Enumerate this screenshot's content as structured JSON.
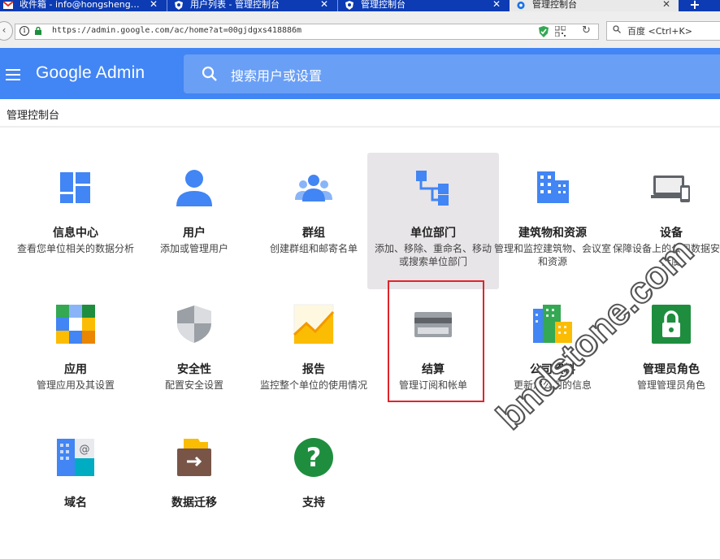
{
  "browser": {
    "tabs": [
      {
        "title": "收件箱 - info@hongsheng…",
        "icon": "gmail-icon",
        "active": false
      },
      {
        "title": "用户列表 - 管理控制台",
        "icon": "admin-icon",
        "active": false
      },
      {
        "title": "管理控制台",
        "icon": "admin-icon",
        "active": false
      },
      {
        "title": "管理控制台",
        "icon": "gear-icon",
        "active": true
      }
    ],
    "close_glyph": "✕",
    "new_tab_glyph": "+",
    "url": "https://admin.google.com/ac/home?at=00gjdgxs418886m",
    "search_placeholder": "百度 <Ctrl+K>"
  },
  "header": {
    "brand": "Google Admin",
    "search_placeholder": "搜索用户或设置",
    "brand_color": "#4285f4"
  },
  "breadcrumb": "管理控制台",
  "tiles": [
    {
      "id": "dashboard",
      "title": "信息中心",
      "desc": "查看您单位相关的数据分析",
      "icon": "dashboard-icon"
    },
    {
      "id": "users",
      "title": "用户",
      "desc": "添加或管理用户",
      "icon": "user-icon"
    },
    {
      "id": "groups",
      "title": "群组",
      "desc": "创建群组和邮寄名单",
      "icon": "group-icon"
    },
    {
      "id": "org-units",
      "title": "单位部门",
      "desc": "添加、移除、重命名、移动或搜索单位部门",
      "icon": "org-unit-icon"
    },
    {
      "id": "buildings",
      "title": "建筑物和资源",
      "desc": "管理和监控建筑物、会议室和资源",
      "icon": "building-icon"
    },
    {
      "id": "devices",
      "title": "设备",
      "desc": "保障设备上的公司数据安全无虞",
      "icon": "devices-icon"
    },
    {
      "id": "apps",
      "title": "应用",
      "desc": "管理应用及其设置",
      "icon": "apps-icon"
    },
    {
      "id": "security",
      "title": "安全性",
      "desc": "配置安全设置",
      "icon": "shield-icon"
    },
    {
      "id": "reports",
      "title": "报告",
      "desc": "监控整个单位的使用情况",
      "icon": "reports-icon"
    },
    {
      "id": "billing",
      "title": "结算",
      "desc": "管理订阅和帐单",
      "icon": "credit-card-icon"
    },
    {
      "id": "company-profile",
      "title": "公司资料",
      "desc": "更新您公司的信息",
      "icon": "company-profile-icon"
    },
    {
      "id": "admin-roles",
      "title": "管理员角色",
      "desc": "管理管理员角色",
      "icon": "lock-icon"
    },
    {
      "id": "domains",
      "title": "域名",
      "desc": "",
      "icon": "domains-icon"
    },
    {
      "id": "data-migration",
      "title": "数据迁移",
      "desc": "",
      "icon": "data-migration-icon"
    },
    {
      "id": "support",
      "title": "支持",
      "desc": "",
      "icon": "help-icon"
    }
  ],
  "watermark": "bndstone.com",
  "colors": {
    "highlight_tile": "#e8e5e8",
    "annotation_box": "#e0242c"
  }
}
